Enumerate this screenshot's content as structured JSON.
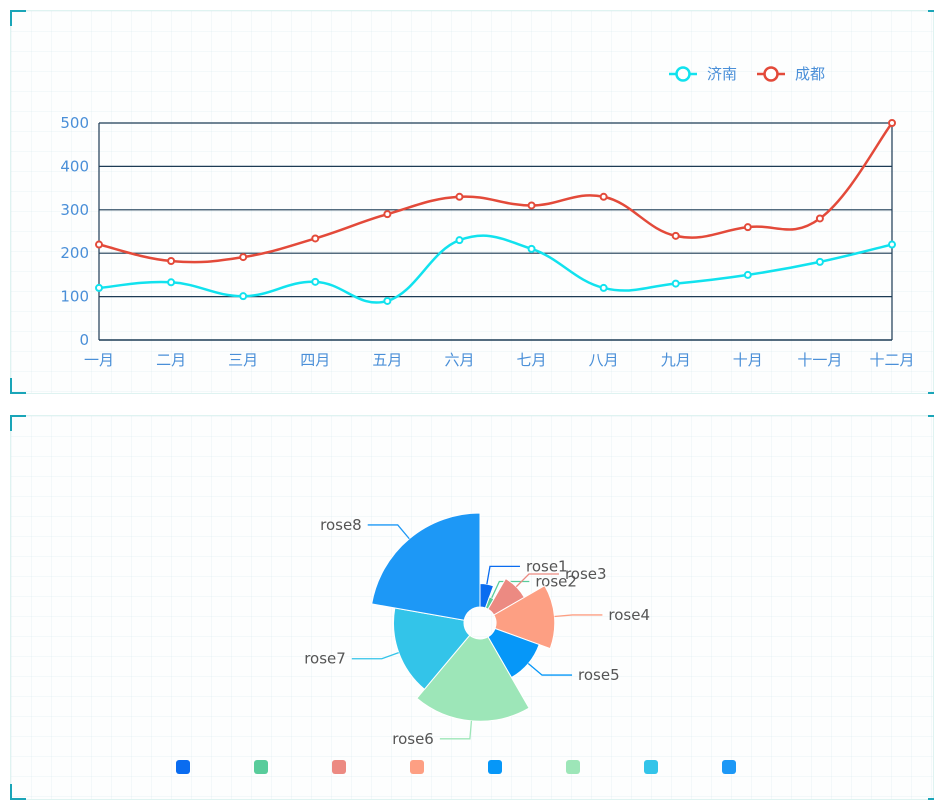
{
  "chart_data": [
    {
      "type": "line",
      "categories": [
        "一月",
        "二月",
        "三月",
        "四月",
        "五月",
        "六月",
        "七月",
        "八月",
        "九月",
        "十月",
        "十一月",
        "十二月"
      ],
      "ylim": [
        0,
        500
      ],
      "yticks": [
        "0",
        "100",
        "200",
        "300",
        "400",
        "500"
      ],
      "smooth": true,
      "grid": true,
      "legend_position": "top-right",
      "series": [
        {
          "name": "济南",
          "color": "#11e2ee",
          "values": [
            120,
            133,
            101,
            134,
            90,
            230,
            210,
            120,
            130,
            150,
            180,
            220
          ]
        },
        {
          "name": "成都",
          "color": "#e34a3a",
          "values": [
            220,
            182,
            191,
            234,
            290,
            330,
            310,
            330,
            240,
            260,
            280,
            500
          ]
        }
      ]
    },
    {
      "type": "pie",
      "rose": true,
      "legend_position": "bottom",
      "slices": [
        {
          "name": "rose1",
          "value": 10,
          "color": "#0a6cf0"
        },
        {
          "name": "rose2",
          "value": 5,
          "color": "#58cc9b"
        },
        {
          "name": "rose3",
          "value": 15,
          "color": "#ec8a82"
        },
        {
          "name": "rose4",
          "value": 25,
          "color": "#fd9f83"
        },
        {
          "name": "rose5",
          "value": 20,
          "color": "#0697f8"
        },
        {
          "name": "rose6",
          "value": 35,
          "color": "#9de6b8"
        },
        {
          "name": "rose7",
          "value": 30,
          "color": "#33c4e9"
        },
        {
          "name": "rose8",
          "value": 40,
          "color": "#1d98f6"
        }
      ]
    }
  ]
}
